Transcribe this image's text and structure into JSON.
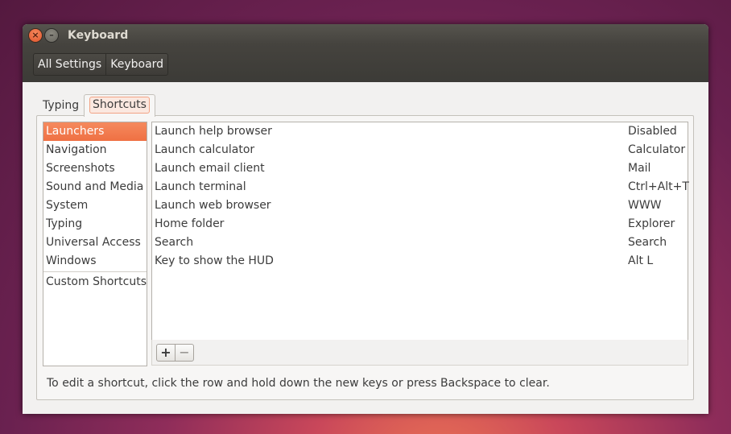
{
  "window": {
    "title": "Keyboard",
    "close_glyph": "×",
    "minimize_glyph": "–"
  },
  "breadcrumb": [
    "All Settings",
    "Keyboard"
  ],
  "tabs": [
    {
      "label": "Typing",
      "active": false
    },
    {
      "label": "Shortcuts",
      "active": true
    }
  ],
  "categories": [
    "Launchers",
    "Navigation",
    "Screenshots",
    "Sound and Media",
    "System",
    "Typing",
    "Universal Access",
    "Windows"
  ],
  "custom_category": "Custom Shortcuts",
  "selected_category": "Launchers",
  "shortcuts": [
    {
      "action": "Launch help browser",
      "accel": "Disabled"
    },
    {
      "action": "Launch calculator",
      "accel": "Calculator"
    },
    {
      "action": "Launch email client",
      "accel": "Mail"
    },
    {
      "action": "Launch terminal",
      "accel": "Ctrl+Alt+T"
    },
    {
      "action": "Launch web browser",
      "accel": "WWW"
    },
    {
      "action": "Home folder",
      "accel": "Explorer"
    },
    {
      "action": "Search",
      "accel": "Search"
    },
    {
      "action": "Key to show the HUD",
      "accel": "Alt L"
    }
  ],
  "toolbar": {
    "add_label": "+",
    "remove_label": "−"
  },
  "hint": "To edit a shortcut, click the row and hold down the new keys or press Backspace to clear.",
  "colors": {
    "accent": "#ef7043",
    "titlebar": "#3c3b37",
    "background": "#f2f1f0"
  }
}
